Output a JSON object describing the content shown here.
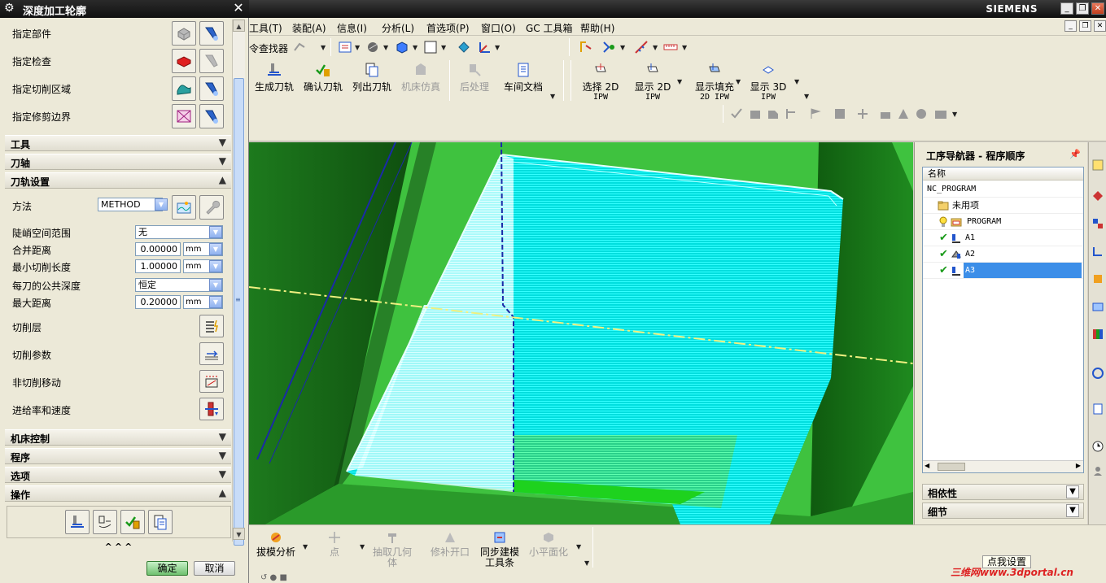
{
  "dialog": {
    "title": "深度加工轮廓",
    "select_rows": [
      {
        "label": "指定部件",
        "icon": "part-icon"
      },
      {
        "label": "指定检查",
        "icon": "check-geometry-icon"
      },
      {
        "label": "指定切削区域",
        "icon": "cut-area-icon"
      },
      {
        "label": "指定修剪边界",
        "icon": "trim-boundary-icon"
      }
    ],
    "sections": {
      "tool": "工具",
      "axis": "刀轴",
      "path_settings": "刀轨设置",
      "machine_control": "机床控制",
      "program": "程序",
      "options": "选项",
      "actions": "操作"
    },
    "path": {
      "method_label": "方法",
      "method_value": "METHOD",
      "steep_label": "陡峭空间范围",
      "steep_value": "无",
      "merge_label": "合并距离",
      "merge_value": "0.00000",
      "merge_unit": "mm",
      "min_cut_label": "最小切削长度",
      "min_cut_value": "1.00000",
      "min_cut_unit": "mm",
      "depth_label": "每刀的公共深度",
      "depth_value": "恒定",
      "max_dist_label": "最大距离",
      "max_dist_value": "0.20000",
      "max_dist_unit": "mm",
      "cut_levels_label": "切削层",
      "cut_params_label": "切削参数",
      "non_cut_label": "非切削移动",
      "feeds_label": "进给率和速度"
    },
    "collapse": "^^^",
    "ok": "确定",
    "cancel": "取消"
  },
  "app": {
    "brand": "SIEMENS",
    "menu": [
      "工具(T)",
      "装配(A)",
      "信息(I)",
      "分析(L)",
      "首选项(P)",
      "窗口(O)",
      "GC 工具箱",
      "帮助(H)"
    ],
    "finder": "令查找器",
    "big_buttons": [
      {
        "label": "生成刀轨",
        "icon": "generate-icon",
        "enabled": true
      },
      {
        "label": "确认刀轨",
        "icon": "verify-icon",
        "enabled": true
      },
      {
        "label": "列出刀轨",
        "icon": "list-icon",
        "enabled": true
      },
      {
        "label": "机床仿真",
        "icon": "machine-sim-icon",
        "enabled": false
      },
      {
        "label": "后处理",
        "icon": "postprocess-icon",
        "enabled": false
      },
      {
        "label": "车间文档",
        "icon": "shop-doc-icon",
        "enabled": true
      }
    ],
    "ipw_buttons": [
      {
        "line1": "选择 2D",
        "line2": "IPW"
      },
      {
        "line1": "显示 2D",
        "line2": "IPW"
      },
      {
        "line1": "显示填充",
        "line2": "2D IPW"
      },
      {
        "line1": "显示 3D",
        "line2": "IPW"
      }
    ]
  },
  "navigator": {
    "title": "工序导航器 - 程序顺序",
    "column": "名称",
    "rows": [
      {
        "label": "NC_PROGRAM",
        "indent": 0,
        "check": false,
        "selected": false,
        "icon": "none"
      },
      {
        "label": "未用项",
        "indent": 1,
        "check": false,
        "selected": false,
        "icon": "folder-icon"
      },
      {
        "label": "PROGRAM",
        "indent": 1,
        "check": false,
        "selected": false,
        "icon": "program-folder-icon"
      },
      {
        "label": "A1",
        "indent": 1,
        "check": true,
        "selected": false,
        "icon": "operation-icon"
      },
      {
        "label": "A2",
        "indent": 1,
        "check": true,
        "selected": false,
        "icon": "operation-icon"
      },
      {
        "label": "A3",
        "indent": 1,
        "check": true,
        "selected": true,
        "icon": "operation-icon"
      }
    ],
    "sections": [
      "相依性",
      "细节"
    ]
  },
  "bottom": {
    "buttons": [
      {
        "label": "拔模分析",
        "enabled": true
      },
      {
        "label": "点",
        "enabled": false
      },
      {
        "label": "抽取几何体",
        "enabled": false
      },
      {
        "label": "修补开口",
        "enabled": false
      },
      {
        "label": "同步建模工具条",
        "enabled": true
      },
      {
        "label": "小平面化",
        "enabled": false
      }
    ],
    "tip": "点我设置",
    "watermark": "三维网www.3dportal.cn"
  },
  "colors": {
    "viewport_green": "#3fc23f",
    "toolpath_cyan": "#00ffff",
    "selection_blue": "#3c8ee8"
  }
}
